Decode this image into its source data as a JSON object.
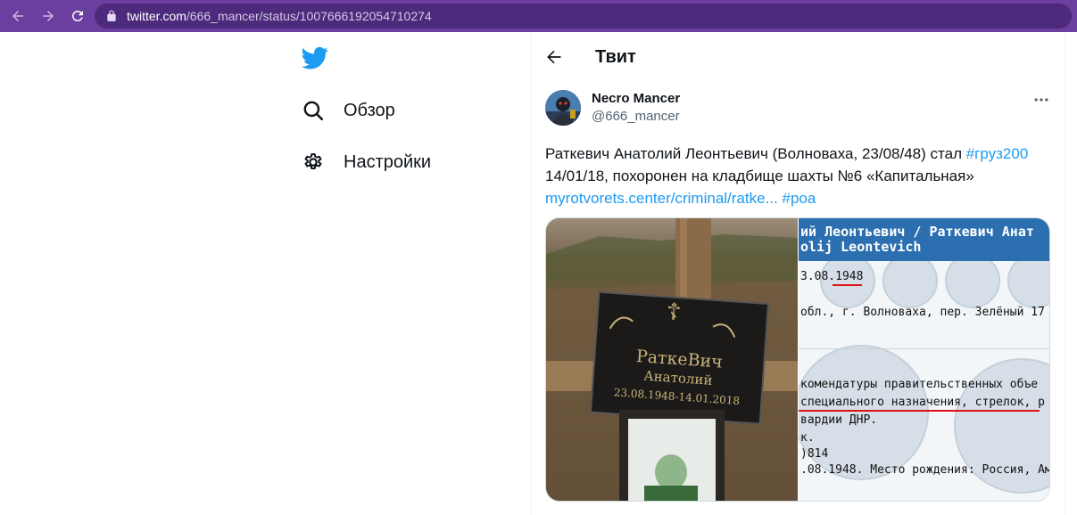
{
  "browser": {
    "url_host": "twitter.com",
    "url_path": "/666_mancer/status/1007666192054710274"
  },
  "nav": {
    "items": [
      {
        "label": "Обзор",
        "icon": "search-icon"
      },
      {
        "label": "Настройки",
        "icon": "gear-icon"
      }
    ]
  },
  "header": {
    "title": "Твит"
  },
  "tweet": {
    "author_name": "Necro Mancer",
    "author_handle": "@666_mancer",
    "line1_text": "Раткевич Анатолий Леонтьевич (Волноваха, 23/08/48) стал ",
    "line1_hashtag": "#груз200",
    "line2_text": "14/01/18, похоронен на кладбище шахты №6 «Капитальная»",
    "line3_link": "myrotvorets.center/criminal/ratke...",
    "line3_hashtag": "#роа"
  },
  "media": {
    "doc_header_line1": "ий Леонтьевич / Раткевич Анат",
    "doc_header_line2": "olij Leontevich",
    "doc_lines": [
      "3.08.1948",
      "обл., г. Волноваха, пер. Зелёный 17",
      " комендатуры правительственных объе",
      " специального назначения, стрелок, р",
      "вардии ДНР.",
      "к.",
      ")814",
      ".08.1948. Место рождения: Россия, Ам"
    ],
    "plaque_line1": "РаткеВич",
    "plaque_line2": "Анатолий",
    "plaque_line3": "23.08.1948-14.01.2018"
  }
}
